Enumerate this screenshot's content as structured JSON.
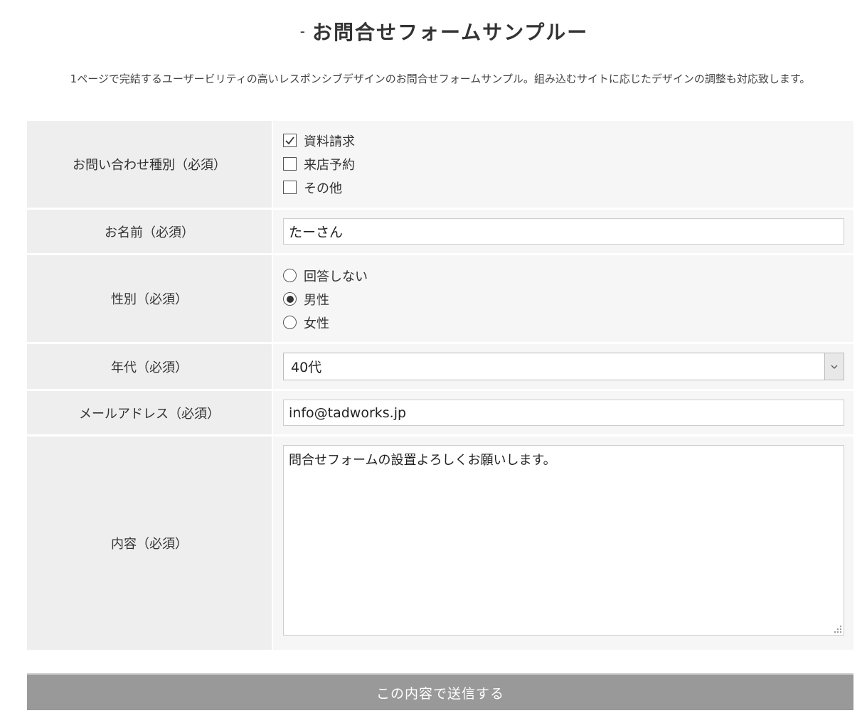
{
  "page": {
    "title": "お問合せフォームサンプル",
    "title_prefix": "-",
    "title_suffix": "ー",
    "lead": "1ページで完結するユーザービリティの高いレスポンシブデザインのお問合せフォームサンプル。組み込むサイトに応じたデザインの調整も対応致します。"
  },
  "form": {
    "inquiry_type": {
      "label": "お問い合わせ種別（必須）",
      "options": [
        {
          "label": "資料請求",
          "checked": true
        },
        {
          "label": "来店予約",
          "checked": false
        },
        {
          "label": "その他",
          "checked": false
        }
      ]
    },
    "name": {
      "label": "お名前（必須）",
      "value": "たーさん"
    },
    "gender": {
      "label": "性別（必須）",
      "options": [
        {
          "label": "回答しない",
          "selected": false
        },
        {
          "label": "男性",
          "selected": true
        },
        {
          "label": "女性",
          "selected": false
        }
      ]
    },
    "age": {
      "label": "年代（必須）",
      "value": "40代"
    },
    "email": {
      "label": "メールアドレス（必須）",
      "value": "info@tadworks.jp"
    },
    "content": {
      "label": "内容（必須）",
      "value": "問合せフォームの設置よろしくお願いします。"
    }
  },
  "submit": {
    "label": "この内容で送信する"
  },
  "icons": {
    "check": "check-icon",
    "radio_dot": "radio-dot-icon",
    "dropdown": "chevron-down-icon",
    "resize": "resize-grip-icon"
  },
  "colors": {
    "label_bg": "#eeeeee",
    "field_bg": "#f6f6f6",
    "submit_bg": "#999999"
  }
}
